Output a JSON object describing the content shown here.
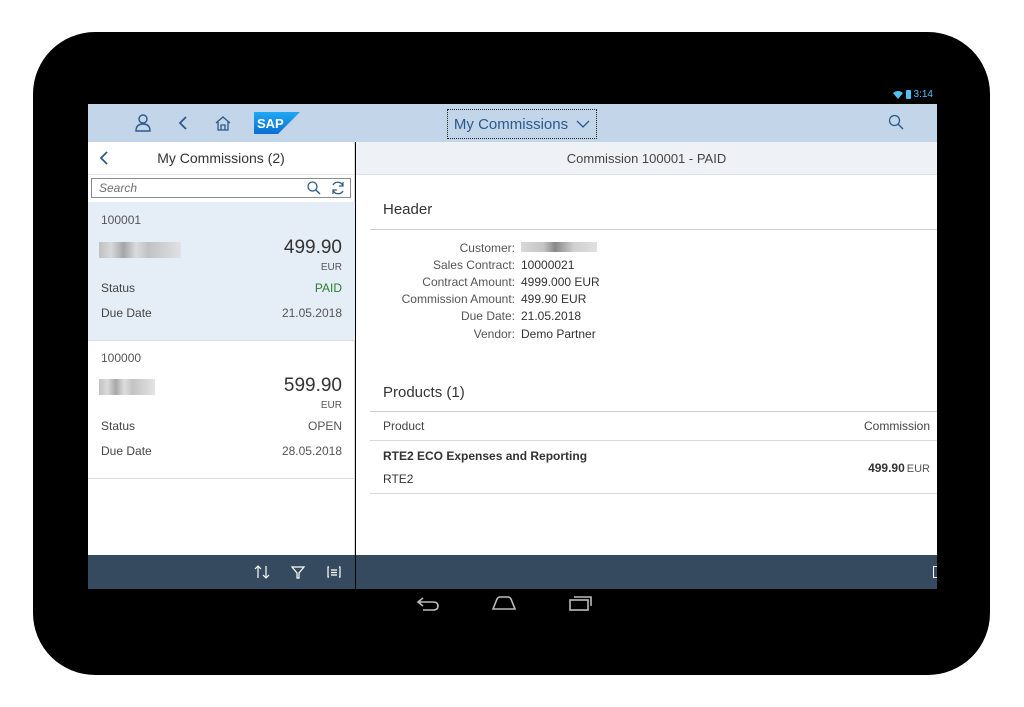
{
  "android_status": {
    "time": "3:14"
  },
  "shell": {
    "title": "My Commissions",
    "icons": [
      "person-icon",
      "back-icon",
      "home-icon",
      "sap-logo",
      "search-icon"
    ]
  },
  "master": {
    "title": "My Commissions (2)",
    "search_placeholder": "Search",
    "items": [
      {
        "id": "100001",
        "amount": "499.90",
        "currency": "EUR",
        "status_label": "Status",
        "status": "PAID",
        "due_label": "Due Date",
        "due": "21.05.2018"
      },
      {
        "id": "100000",
        "amount": "599.90",
        "currency": "EUR",
        "status_label": "Status",
        "status": "OPEN",
        "due_label": "Due Date",
        "due": "28.05.2018"
      }
    ]
  },
  "detail": {
    "title": "Commission 100001 - PAID",
    "header_section": "Header",
    "fields": [
      {
        "label": "Customer:",
        "value": ""
      },
      {
        "label": "Sales Contract:",
        "value": "10000021"
      },
      {
        "label": "Contract Amount:",
        "value": "4999.000 EUR"
      },
      {
        "label": "Commission Amount:",
        "value": "499.90 EUR"
      },
      {
        "label": "Due Date:",
        "value": "21.05.2018"
      },
      {
        "label": "Vendor:",
        "value": "Demo Partner"
      }
    ],
    "products_section": "Products (1)",
    "table": {
      "col_product": "Product",
      "col_commission": "Commission",
      "rows": [
        {
          "name": "RTE2 ECO Expenses and Reporting",
          "code": "RTE2",
          "amount": "499.90",
          "currency": "EUR"
        }
      ]
    }
  },
  "colors": {
    "shell": "#c3d5e8",
    "footer": "#354a5f",
    "selected": "#e5edf6",
    "paid": "#2b7d2b",
    "sap_blue": "#1a8fe0"
  }
}
